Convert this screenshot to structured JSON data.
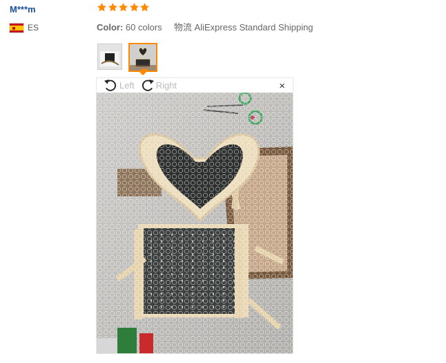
{
  "review": {
    "user_name": "M***m",
    "country_code": "ES",
    "rating_stars": 5,
    "color_label": "Color:",
    "color_value": "60 colors",
    "shipping_label": "物流",
    "shipping_value": "AliExpress Standard Shipping"
  },
  "viewer": {
    "rotate_left_label": "Left",
    "rotate_right_label": "Right",
    "close_glyph": "×",
    "selected_thumbnail": 2
  },
  "icons": {
    "star": "star-icon",
    "rotate_left": "rotate-left-icon",
    "rotate_right": "rotate-right-icon",
    "close": "close-icon",
    "flag": "spain-flag-icon"
  },
  "colors": {
    "username": "#1a4fa0",
    "star": "#ff8a00",
    "selected_border": "#ff8a00"
  }
}
